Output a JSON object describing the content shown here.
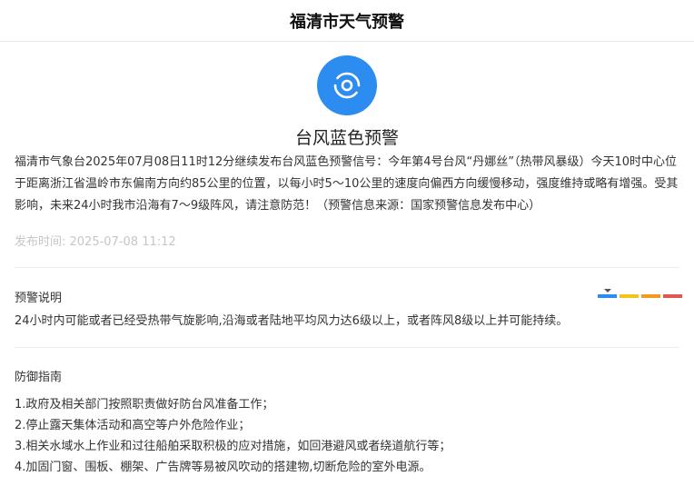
{
  "header": {
    "title": "福清市天气预警"
  },
  "alert": {
    "icon": "typhoon-icon",
    "icon_color": "#2d8cf0",
    "title": "台风蓝色预警",
    "description": "福清市气象台2025年07月08日11时12分继续发布台风蓝色预警信号：今年第4号台风“丹娜丝”（热带风暴级）今天10时中心位于距离浙江省温岭市东偏南方向约85公里的位置，以每小时5～10公里的速度向偏西方向缓慢移动，强度维持或略有增强。受其影响，未来24小时我市沿海有7～9级阵风，请注意防范！（预警信息来源：国家预警信息发布中心）",
    "publish_time": "发布时间: 2025-07-08 11:12"
  },
  "explanation": {
    "title": "预警说明",
    "text": "24小时内可能或者已经受热带气旋影响,沿海或者陆地平均风力达6级以上，或者阵风8级以上并可能持续。",
    "level_colors": [
      "#2d8cf0",
      "#f2c318",
      "#f29a1f",
      "#e2574c"
    ],
    "current_level": "blue"
  },
  "guide": {
    "title": "防御指南",
    "items": [
      "1.政府及相关部门按照职责做好防台风准备工作；",
      "2.停止露天集体活动和高空等户外危险作业；",
      "3.相关水域水上作业和过往船舶采取积极的应对措施，如回港避风或者绕道航行等；",
      "4.加固门窗、围板、棚架、广告牌等易被风吹动的搭建物,切断危险的室外电源。"
    ]
  }
}
